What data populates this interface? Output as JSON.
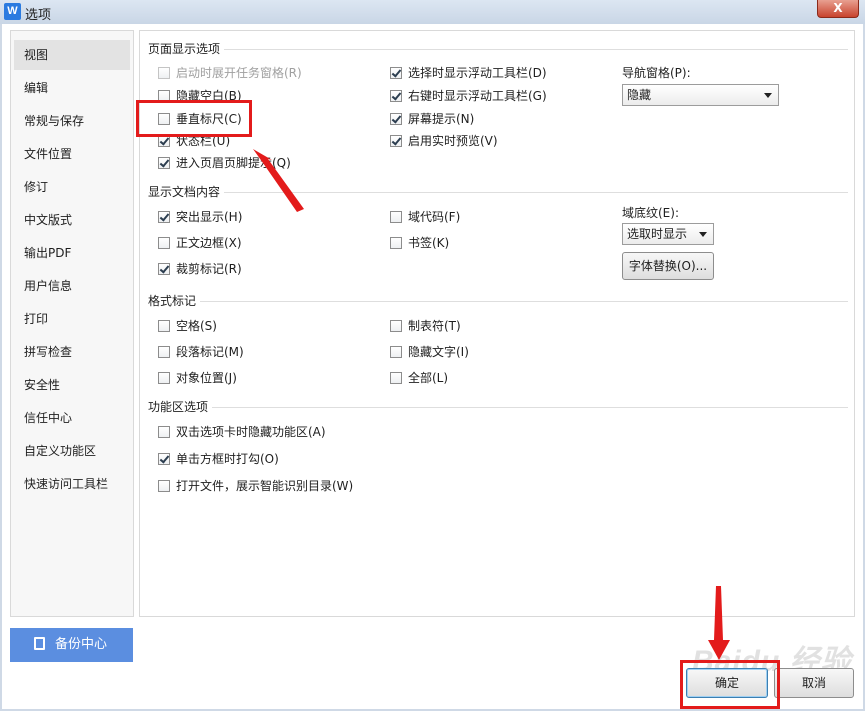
{
  "window": {
    "title": "选项",
    "app_icon": "W",
    "close_glyph": "X"
  },
  "sidebar": {
    "items": [
      {
        "label": "视图",
        "active": true
      },
      {
        "label": "编辑"
      },
      {
        "label": "常规与保存"
      },
      {
        "label": "文件位置"
      },
      {
        "label": "修订"
      },
      {
        "label": "中文版式"
      },
      {
        "label": "输出PDF"
      },
      {
        "label": "用户信息"
      },
      {
        "label": "打印"
      },
      {
        "label": "拼写检查"
      },
      {
        "label": "安全性"
      },
      {
        "label": "信任中心"
      },
      {
        "label": "自定义功能区"
      },
      {
        "label": "快速访问工具栏"
      }
    ],
    "backup_center": "备份中心"
  },
  "page_display": {
    "title": "页面显示选项",
    "left": [
      {
        "label": "启动时展开任务窗格(R)",
        "checked": false,
        "disabled": true
      },
      {
        "label": "隐藏空白(B)",
        "checked": false
      },
      {
        "label": "垂直标尺(C)",
        "checked": false
      },
      {
        "label": "状态栏(U)",
        "checked": true
      },
      {
        "label": "进入页眉页脚提示(Q)",
        "checked": true
      }
    ],
    "right": [
      {
        "label": "选择时显示浮动工具栏(D)",
        "checked": true
      },
      {
        "label": "右键时显示浮动工具栏(G)",
        "checked": true
      },
      {
        "label": "屏幕提示(N)",
        "checked": true
      },
      {
        "label": "启用实时预览(V)",
        "checked": true
      }
    ],
    "nav_label": "导航窗格(P):",
    "nav_value": "隐藏"
  },
  "doc_content": {
    "title": "显示文档内容",
    "left": [
      {
        "label": "突出显示(H)",
        "checked": true
      },
      {
        "label": "正文边框(X)",
        "checked": false
      },
      {
        "label": "裁剪标记(R)",
        "checked": true
      }
    ],
    "right": [
      {
        "label": "域代码(F)",
        "checked": false
      },
      {
        "label": "书签(K)",
        "checked": false
      }
    ],
    "field_shading_label": "域底纹(E):",
    "field_shading_value": "选取时显示",
    "font_replace": "字体替换(O)..."
  },
  "format_marks": {
    "title": "格式标记",
    "left": [
      {
        "label": "空格(S)",
        "checked": false
      },
      {
        "label": "段落标记(M)",
        "checked": false
      },
      {
        "label": "对象位置(J)",
        "checked": false
      }
    ],
    "right": [
      {
        "label": "制表符(T)",
        "checked": false
      },
      {
        "label": "隐藏文字(I)",
        "checked": false
      },
      {
        "label": "全部(L)",
        "checked": false
      }
    ]
  },
  "ribbon": {
    "title": "功能区选项",
    "items": [
      {
        "label": "双击选项卡时隐藏功能区(A)",
        "checked": false
      },
      {
        "label": "单击方框时打勾(O)",
        "checked": true
      },
      {
        "label": "打开文件，展示智能识别目录(W)",
        "checked": false
      }
    ]
  },
  "footer": {
    "ok": "确定",
    "cancel": "取消"
  },
  "watermark": "Baidu 经验",
  "colors": {
    "accent": "#5b8ee0",
    "highlight": "#e31b1b"
  }
}
